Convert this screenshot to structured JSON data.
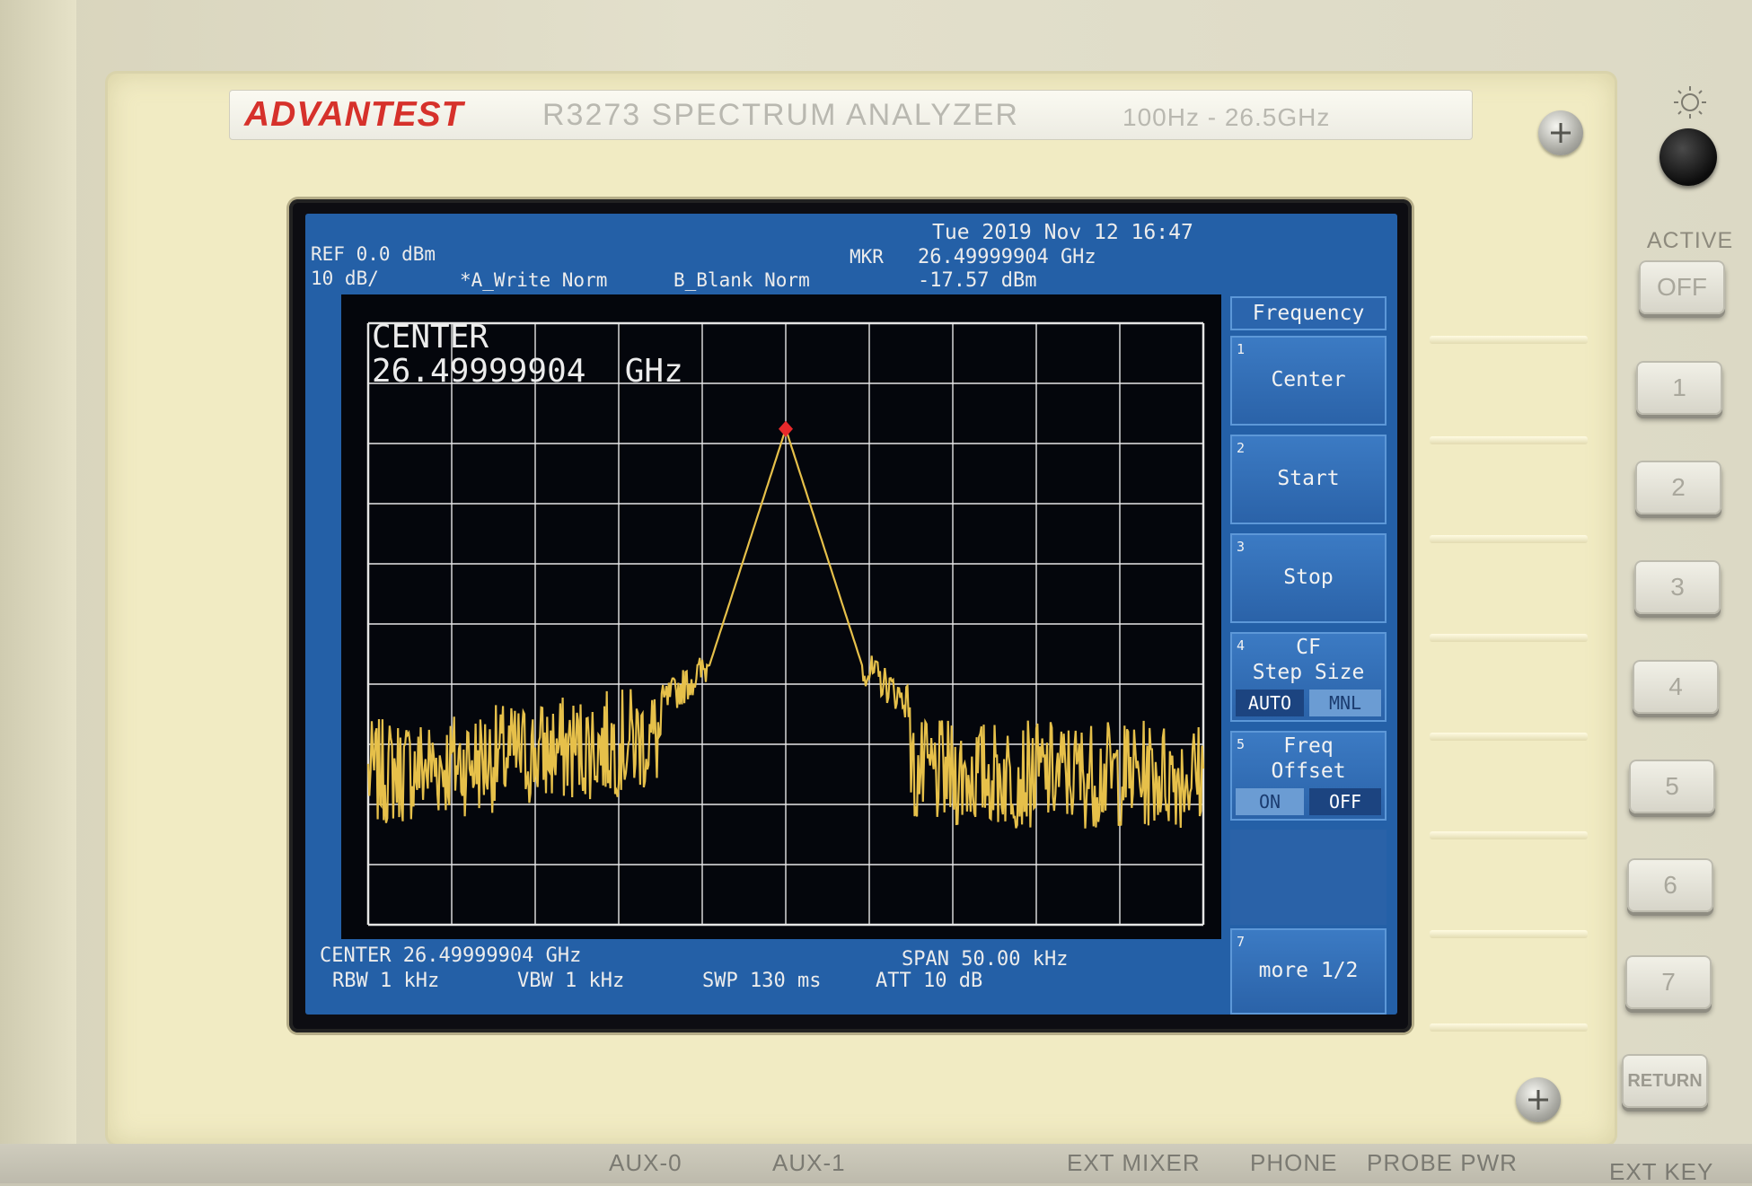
{
  "device": {
    "brand": "ADVANTEST",
    "model_title": "R3273  SPECTRUM  ANALYZER",
    "freq_range": "100Hz - 26.5GHz"
  },
  "status": {
    "datetime": "Tue 2019 Nov 12 16:47",
    "ref_level": "REF 0.0 dBm",
    "scale": "10 dB/",
    "trace_a": "*A_Write Norm",
    "trace_b": "B_Blank Norm",
    "marker_label": "MKR",
    "marker_freq": "26.49999904 GHz",
    "marker_level": "-17.57 dBm"
  },
  "plot_overlay": {
    "line1": "CENTER",
    "line2": "26.49999904  GHz"
  },
  "bottom": {
    "center": "CENTER 26.49999904 GHz",
    "span": "SPAN 50.00 kHz",
    "rbw": "RBW 1 kHz",
    "vbw": "VBW 1 kHz",
    "swp": "SWP 130 ms",
    "att": "ATT 10 dB"
  },
  "softkeys": {
    "title": "Frequency",
    "k1": {
      "num": "1",
      "label": "Center"
    },
    "k2": {
      "num": "2",
      "label": "Start"
    },
    "k3": {
      "num": "3",
      "label": "Stop"
    },
    "k4": {
      "num": "4",
      "label1": "CF",
      "label2": "Step Size",
      "opt_a": "AUTO",
      "opt_b": "MNL",
      "selected": "AUTO"
    },
    "k5": {
      "num": "5",
      "label1": "Freq",
      "label2": "Offset",
      "opt_a": "ON",
      "opt_b": "OFF",
      "selected": "OFF"
    },
    "k7": {
      "num": "7",
      "label": "more 1/2"
    }
  },
  "hardware": {
    "active_label": "ACTIVE",
    "off_button": "OFF",
    "numbered_buttons": [
      "1",
      "2",
      "3",
      "4",
      "5",
      "6",
      "7"
    ],
    "return_button": "RETURN",
    "connectors": [
      "AUX-0",
      "AUX-1",
      "EXT MIXER",
      "PHONE",
      "PROBE PWR",
      "EXT KEY"
    ]
  },
  "colors": {
    "screen_bg": "#2460a7",
    "plot_bg": "#04060c",
    "trace": "#e6c04a",
    "marker": "#e8292b",
    "grid": "#e6e6e6",
    "brand": "#d6312b"
  },
  "chart_data": {
    "type": "line",
    "x_center_ghz": 26.49999904,
    "span_khz": 50.0,
    "ref_level_dbm": 0.0,
    "scale_db_per_div": 10,
    "divisions": {
      "x": 10,
      "y": 10
    },
    "ylim": [
      -100,
      0
    ],
    "marker": {
      "freq_ghz": 26.49999904,
      "level_dbm": -17.57
    },
    "noise_floor_dbm": -75,
    "series": [
      {
        "name": "A_Write Norm"
      }
    ]
  }
}
